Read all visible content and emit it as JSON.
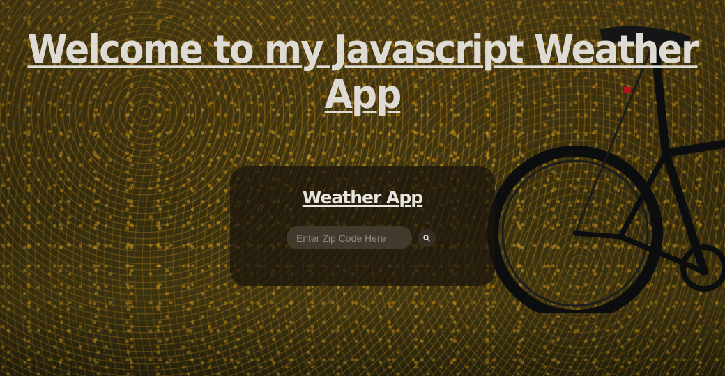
{
  "header": {
    "title": "Welcome to my Javascript Weather App"
  },
  "card": {
    "title": "Weather App",
    "search": {
      "placeholder": "Enter Zip Code Here",
      "value": "",
      "button_icon": "search-icon"
    }
  },
  "colors": {
    "title_text": "#dedad4",
    "card_bg": "#19140c",
    "input_bg": "#463e32"
  }
}
